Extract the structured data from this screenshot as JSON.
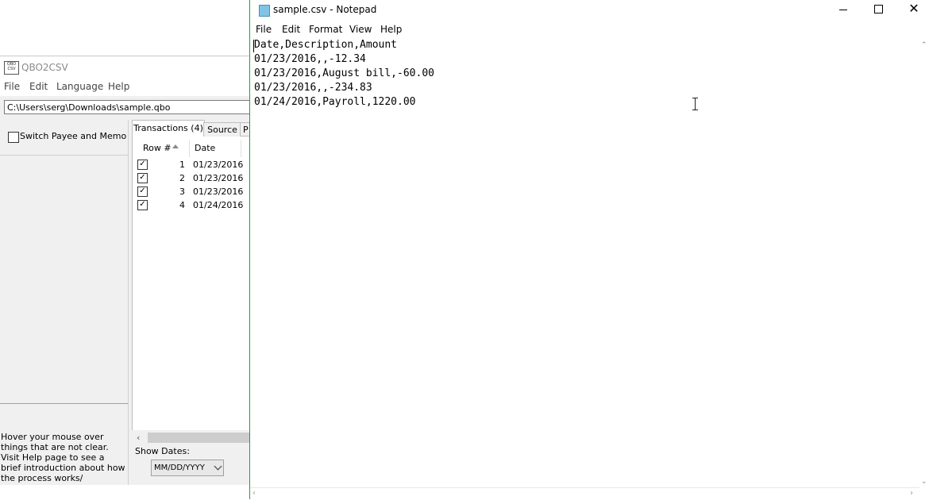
{
  "qbo2csv": {
    "title": "QBO2CSV",
    "logo_text": "QBO CSV",
    "menu": [
      "File",
      "Edit",
      "Language",
      "Help"
    ],
    "file_path": "C:\\Users\\serg\\Downloads\\sample.qbo",
    "switch_label": "Switch Payee and Memo",
    "hint": "Hover your mouse over things that are not clear. Visit Help page to see a brief introduction about how the process works/",
    "tabs": [
      "Transactions (4)",
      "Source",
      "P"
    ],
    "columns": [
      "Row #",
      "Date"
    ],
    "rows": [
      {
        "num": "1",
        "date": "01/23/2016",
        "checked": true
      },
      {
        "num": "2",
        "date": "01/23/2016",
        "checked": true
      },
      {
        "num": "3",
        "date": "01/23/2016",
        "checked": true
      },
      {
        "num": "4",
        "date": "01/24/2016",
        "checked": true
      }
    ],
    "show_dates_label": "Show Dates:",
    "date_format": "MM/DD/YYYY"
  },
  "notepad": {
    "title": "sample.csv - Notepad",
    "menu": [
      "File",
      "Edit",
      "Format",
      "View",
      "Help"
    ],
    "lines": [
      "Date,Description,Amount",
      "01/23/2016,,-12.34",
      "01/23/2016,August bill,-60.00",
      "01/23/2016,,-234.83",
      "01/24/2016,Payroll,1220.00"
    ]
  },
  "icons": {
    "close": "✕",
    "checkmark": "✓",
    "scroll_left": "‹",
    "scroll_right": "›",
    "scroll_up": "⌃",
    "scroll_down": "⌄"
  },
  "colors": {
    "notepad_border": "#1aa33a",
    "dialog_bg": "#f0f0f0"
  }
}
